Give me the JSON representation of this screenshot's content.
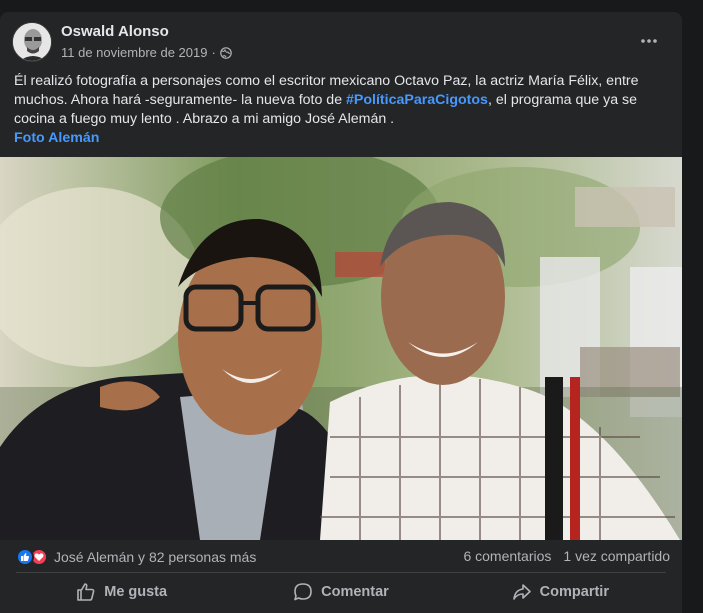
{
  "post": {
    "author": "Oswald Alonso",
    "date": "11 de noviembre de 2019",
    "separator": "·",
    "audience_icon": "globe-icon",
    "more_icon": "ellipsis-icon",
    "text_before": "Él realizó fotografía  a personajes como el escritor mexicano Octavo Paz, la actriz María Félix, entre muchos.  Ahora hará -seguramente-  la nueva foto de ",
    "hashtag": "#PolíticaParaCigotos",
    "text_after": ", el programa que ya se cocina a fuego  muy lento . Abrazo a mi amigo José Alemán  .",
    "photo_link": "Foto Alemán"
  },
  "stats": {
    "reactions_text": "José Alemán y 82 personas más",
    "comments": "6 comentarios",
    "shares": "1 vez compartido"
  },
  "actions": {
    "like": "Me gusta",
    "comment": "Comentar",
    "share": "Compartir"
  },
  "colors": {
    "background": "#18191a",
    "card": "#242526",
    "link": "#4599ff",
    "like": "#1877f2",
    "love": "#f33e58"
  }
}
